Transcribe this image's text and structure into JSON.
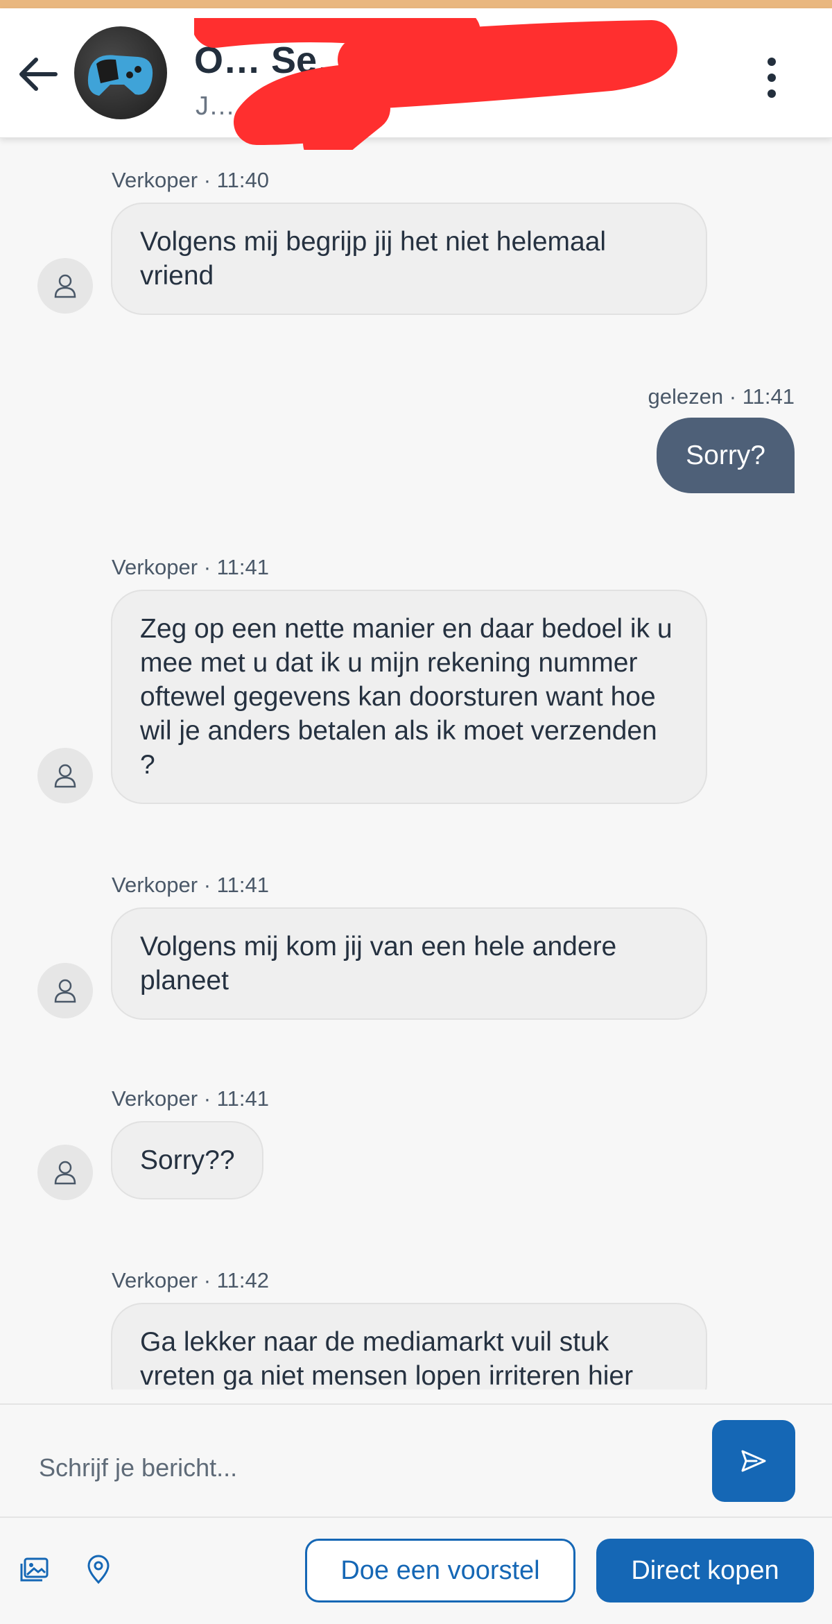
{
  "header": {
    "title": "O… Se… g…",
    "subtitle": "J… …for",
    "colors": {
      "accent_strip": "#e9b77f",
      "redaction": "#ff2f2f"
    },
    "icons": {
      "back": "arrow-left-icon",
      "menu": "more-vertical-icon",
      "avatar": "game-controller-photo"
    }
  },
  "messages": [
    {
      "sender": "Verkoper",
      "time": "11:40",
      "text": "Volgens mij begrijp jij het niet helemaal vriend"
    },
    {
      "status": "gelezen",
      "time": "11:41",
      "text": "Sorry?"
    },
    {
      "sender": "Verkoper",
      "time": "11:41",
      "text": "Zeg op een nette manier en daar bedoel ik u mee met u dat ik u mijn rekening nummer oftewel gegevens kan doorsturen want hoe wil je anders betalen als ik moet verzenden ?"
    },
    {
      "sender": "Verkoper",
      "time": "11:41",
      "text": "Volgens mij kom jij van een hele andere planeet"
    },
    {
      "sender": "Verkoper",
      "time": "11:41",
      "text": "Sorry??"
    },
    {
      "sender": "Verkoper",
      "time": "11:42",
      "text": "Ga lekker naar de mediamarkt vuil stuk vreten ga niet mensen lopen irriteren hier"
    }
  ],
  "composer": {
    "placeholder": "Schrijf je bericht...",
    "value": ""
  },
  "actions": {
    "make_offer": "Doe een voorstel",
    "buy_now": "Direct kopen",
    "icons": {
      "gallery": "image-gallery-icon",
      "location": "location-pin-icon",
      "send": "send-icon"
    },
    "colors": {
      "primary": "#1567b5",
      "outgoing_bubble": "#4e6078"
    }
  },
  "separator": "·"
}
